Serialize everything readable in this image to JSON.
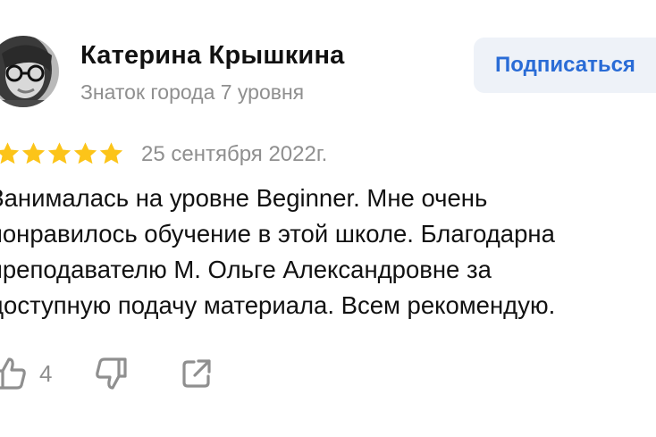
{
  "author": {
    "name": "Катерина Крышкина",
    "level": "Знаток города 7 уровня",
    "avatar_icon": "user-photo"
  },
  "subscribe": {
    "label": "Подписаться",
    "color": "#2a6cd6",
    "background": "#eef2f8"
  },
  "rating": {
    "value": 5,
    "max": 5,
    "star_color": "#fcc419",
    "icon": "star-icon"
  },
  "date": "25 сентября 2022г.",
  "review": {
    "lines": [
      "Занималась на уровне Beginner. Мне очень",
      "понравилось обучение в этой школе. Благодарна",
      "преподавателю М. Ольге Александровне за",
      "доступную подачу материала. Всем рекомендую."
    ]
  },
  "actions": {
    "like_icon": "thumbs-up-icon",
    "likes_count": "4",
    "dislike_icon": "thumbs-down-icon",
    "share_icon": "share-icon"
  }
}
